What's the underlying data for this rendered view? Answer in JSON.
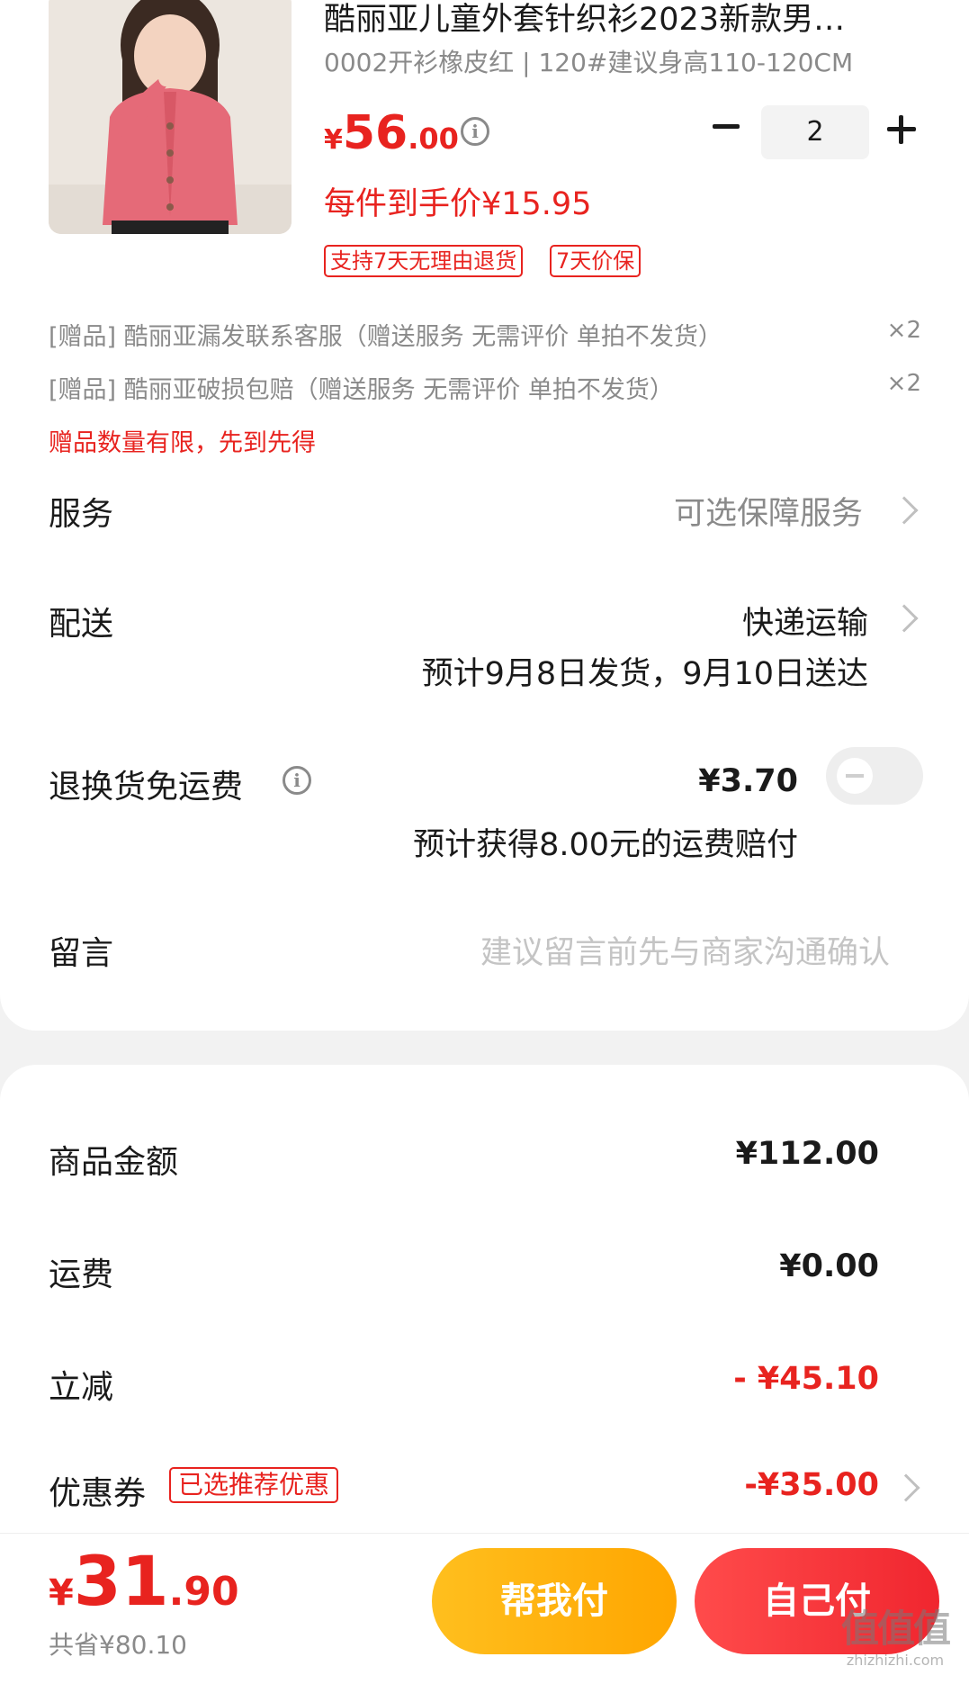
{
  "product": {
    "title": "酷丽亚儿童外套针织衫2023新款男…",
    "spec": "0002开衫橡皮红 | 120#建议身高110-120CM",
    "price_currency": "¥",
    "price_int": "56",
    "price_dec": ".00",
    "quantity": "2",
    "unit_price": "每件到手价¥15.95",
    "tags": [
      "支持7天无理由退货",
      "7天价保"
    ]
  },
  "gifts": [
    {
      "text": "[赠品]   酷丽亚漏发联系客服（赠送服务 无需评价 单拍不发货）",
      "qty": "×2"
    },
    {
      "text": "[赠品]   酷丽亚破损包赔（赠送服务 无需评价 单拍不发货）",
      "qty": "×2"
    }
  ],
  "gift_note": "赠品数量有限，先到先得",
  "service": {
    "label": "服务",
    "value": "可选保障服务"
  },
  "delivery": {
    "label": "配送",
    "value": "快递运输",
    "estimate": "预计9月8日发货，9月10日送达"
  },
  "return_shipping": {
    "label": "退换货免运费",
    "price": "¥3.70",
    "note": "预计获得8.00元的运费赔付",
    "enabled": false
  },
  "message": {
    "label": "留言",
    "placeholder": "建议留言前先与商家沟通确认"
  },
  "summary": {
    "goods_label": "商品金额",
    "goods_value": "¥112.00",
    "shipping_label": "运费",
    "shipping_value": "¥0.00",
    "discount_label": "立减",
    "discount_value": "- ¥45.10",
    "coupon_label": "优惠券",
    "coupon_tag": "已选推荐优惠",
    "coupon_value": "-¥35.00"
  },
  "footer": {
    "total_currency": "¥",
    "total_int": "31",
    "total_dec": ".90",
    "saved": "共省¥80.10",
    "help_pay": "帮我付",
    "self_pay": "自己付"
  },
  "watermark": {
    "big": "值值值",
    "small": "zhizhizhi.com"
  },
  "colors": {
    "accent_red": "#e8231f",
    "help_button": "#ffb40f",
    "self_button": "#f0262f"
  },
  "icons": [
    "info-icon",
    "minus-icon",
    "plus-icon",
    "chevron-right-icon",
    "toggle-switch"
  ]
}
